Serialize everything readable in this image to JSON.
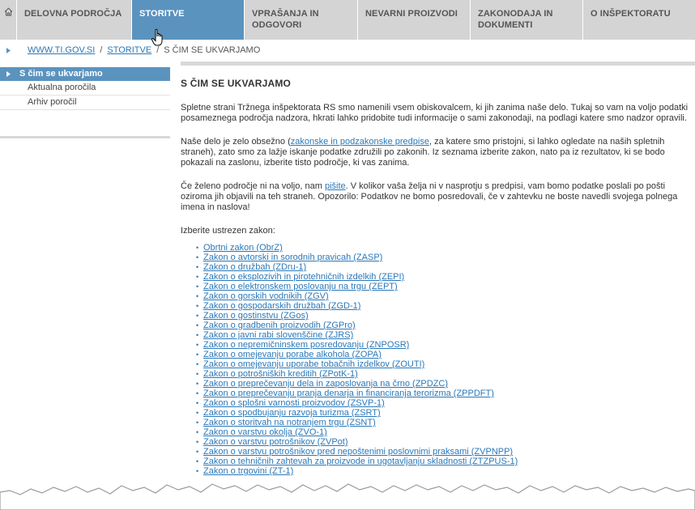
{
  "nav": {
    "tabs": [
      {
        "label": "DELOVNA PODROČJA",
        "active": false
      },
      {
        "label": "STORITVE",
        "active": true
      },
      {
        "label": "VPRAŠANJA IN ODGOVORI",
        "active": false
      },
      {
        "label": "NEVARNI PROIZVODI",
        "active": false
      },
      {
        "label": "ZAKONODAJA IN DOKUMENTI",
        "active": false
      },
      {
        "label": "O INŠPEKTORATU",
        "active": false
      }
    ],
    "active_color": "#5b93bf",
    "inactive_color": "#d4d4d4"
  },
  "breadcrumb": {
    "home": "WWW.TI.GOV.SI",
    "separator": "/",
    "section": "STORITVE",
    "current": "S ČIM SE UKVARJAMO"
  },
  "sidebar": {
    "active": "S čim se ukvarjamo",
    "items": [
      "Aktualna poročila",
      "Arhiv poročil"
    ]
  },
  "main": {
    "title": "S ČIM SE UKVARJAMO",
    "p1": "Spletne strani Tržnega inšpektorata RS smo namenili vsem obiskovalcem, ki jih zanima naše delo. Tukaj so vam na voljo podatki posameznega področja nadzora, hkrati lahko pridobite tudi informacije o sami zakonodaji, na podlagi katere smo nadzor opravili.",
    "p2_before": "Naše delo je zelo obsežno (",
    "p2_link": "zakonske in podzakonske predpise",
    "p2_after": ", za katere smo pristojni, si lahko ogledate na naših spletnih straneh), zato smo za lažje iskanje podatke združili po zakonih. Iz seznama izberite zakon, nato pa iz rezultatov, ki se bodo pokazali na zaslonu, izberite tisto področje, ki vas zanima.",
    "p3_before": "Če želeno področje ni na voljo, nam ",
    "p3_link": "pišite",
    "p3_after": ". V kolikor vaša želja ni v nasprotju s predpisi, vam bomo podatke poslali po pošti oziroma jih objavili na teh straneh. Opozorilo: Podatkov ne bomo posredovali, če v zahtevku ne boste navedli svojega polnega imena in naslova!",
    "p4": "Izberite ustrezen zakon:",
    "laws": [
      "Obrtni zakon (ObrZ)",
      "Zakon o avtorski in sorodnih pravicah (ZASP)",
      "Zakon o družbah (ZDru-1)",
      "Zakon o eksplozivih in pirotehničnih izdelkih (ZEPI)",
      "Zakon o elektronskem poslovanju na trgu (ZEPT)",
      "Zakon o gorskih vodnikih (ZGV)",
      "Zakon o gospodarskih družbah (ZGD-1)",
      "Zakon o gostinstvu (ZGos)",
      "Zakon o gradbenih proizvodih (ZGPro)",
      "Zakon o javni rabi slovenščine (ZJRS)",
      "Zakon o nepremičninskem posredovanju (ZNPOSR)",
      "Zakon o omejevanju porabe alkohola (ZOPA)",
      "Zakon o omejevanju uporabe tobačnih izdelkov (ZOUTI)",
      "Zakon o potrošniških kreditih (ZPotK-1)",
      "Zakon o preprečevanju dela in zaposlovanja na črno (ZPDZC)",
      "Zakon o preprečevanju pranja denarja in financiranja terorizma (ZPPDFT)",
      "Zakon o splošni varnosti proizvodov (ZSVP-1)",
      "Zakon o spodbujanju razvoja turizma (ZSRT)",
      "Zakon o storitvah na notranjem trgu (ZSNT)",
      "Zakon o varstvu okolja (ZVO-1)",
      "Zakon o varstvu potrošnikov (ZVPot)",
      "Zakon o varstvu potrošnikov pred nepoštenimi poslovnimi praksami (ZVPNPP)",
      "Zakon o tehničnih zahtevah za proizvode in ugotavljanju skladnosti (ZTZPUS-1)",
      "Zakon o trgovini (ZT-1)"
    ]
  },
  "colors": {
    "link": "#2a78b8",
    "text": "#333333"
  }
}
